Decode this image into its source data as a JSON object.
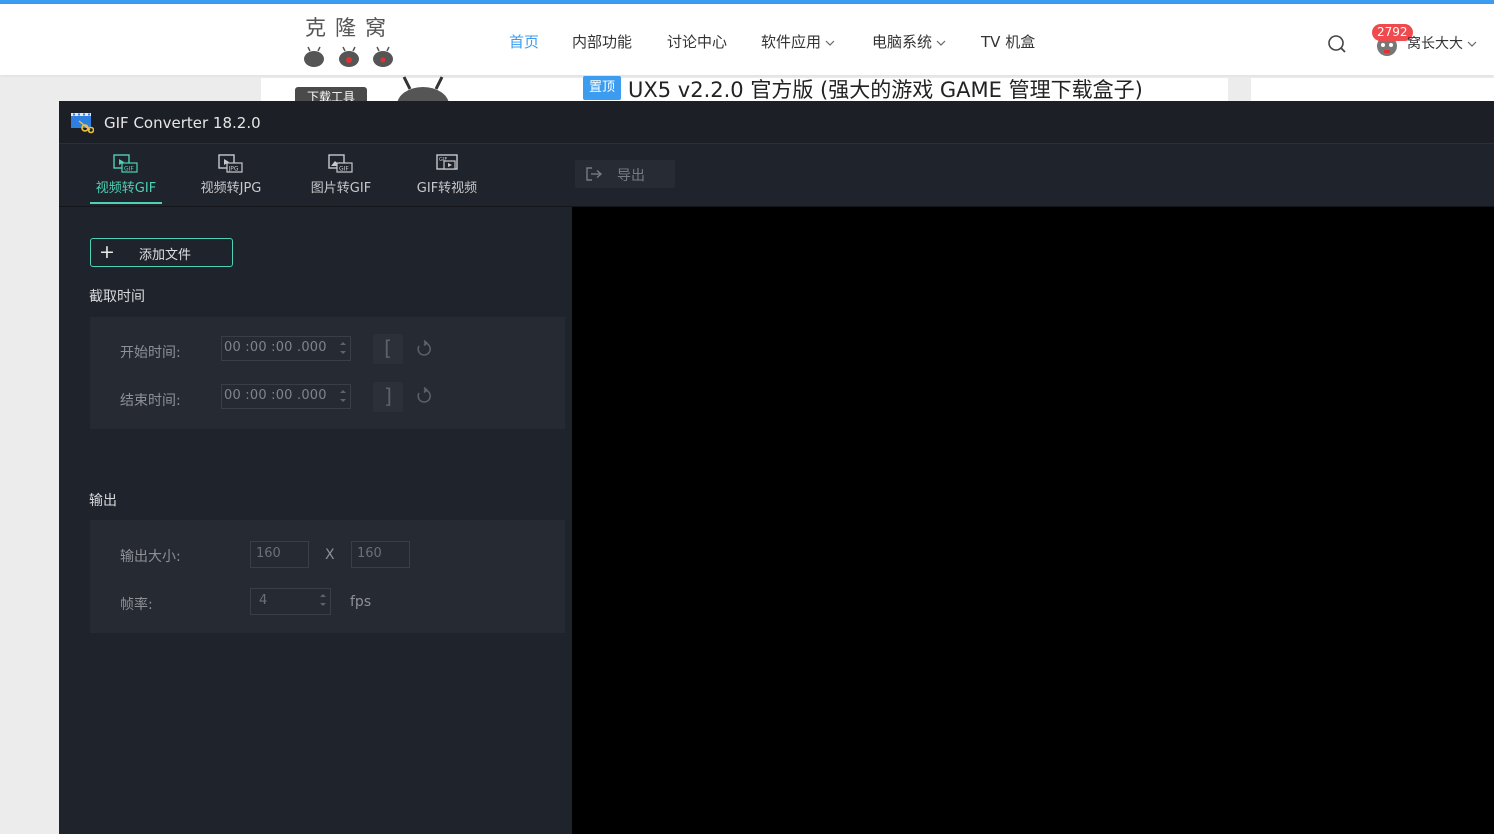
{
  "site": {
    "logo_text": "克隆窝",
    "nav": [
      {
        "label": "首页",
        "active": true,
        "dropdown": false
      },
      {
        "label": "内部功能",
        "active": false,
        "dropdown": false
      },
      {
        "label": "讨论中心",
        "active": false,
        "dropdown": false
      },
      {
        "label": "软件应用",
        "active": false,
        "dropdown": true
      },
      {
        "label": "电脑系统",
        "active": false,
        "dropdown": true
      },
      {
        "label": "TV 机盒",
        "active": false,
        "dropdown": false
      }
    ],
    "user": {
      "badge": "2792",
      "name": "窝长大大"
    },
    "download_tag": "下载工具",
    "pin_badge": "置顶",
    "article_title": "UX5 v2.2.0 官方版 (强大的游戏 GAME 管理下载盒子)",
    "accent_color": "#3b9cf0"
  },
  "app": {
    "title": "GIF Converter 18.2.0",
    "tabs": [
      {
        "label": "视频转GIF",
        "icon": "video-to-gif-icon",
        "active": true
      },
      {
        "label": "视频转JPG",
        "icon": "video-to-jpg-icon",
        "active": false
      },
      {
        "label": "图片转GIF",
        "icon": "image-to-gif-icon",
        "active": false
      },
      {
        "label": "GIF转视频",
        "icon": "gif-to-video-icon",
        "active": false
      }
    ],
    "export_label": "导出",
    "add_file_label": "添加文件",
    "capture_section": {
      "label": "截取时间",
      "start_label": "开始时间:",
      "start_value": "00 :00 :00 .000",
      "end_label": "结束时间:",
      "end_value": "00 :00 :00 .000",
      "start_bracket": "[",
      "end_bracket": "]"
    },
    "output_section": {
      "label": "输出",
      "size_label": "输出大小:",
      "width": "160",
      "height": "160",
      "size_separator": "X",
      "fps_label": "帧率:",
      "fps": "4",
      "fps_unit": "fps"
    },
    "accent_color": "#4fd1b5"
  }
}
